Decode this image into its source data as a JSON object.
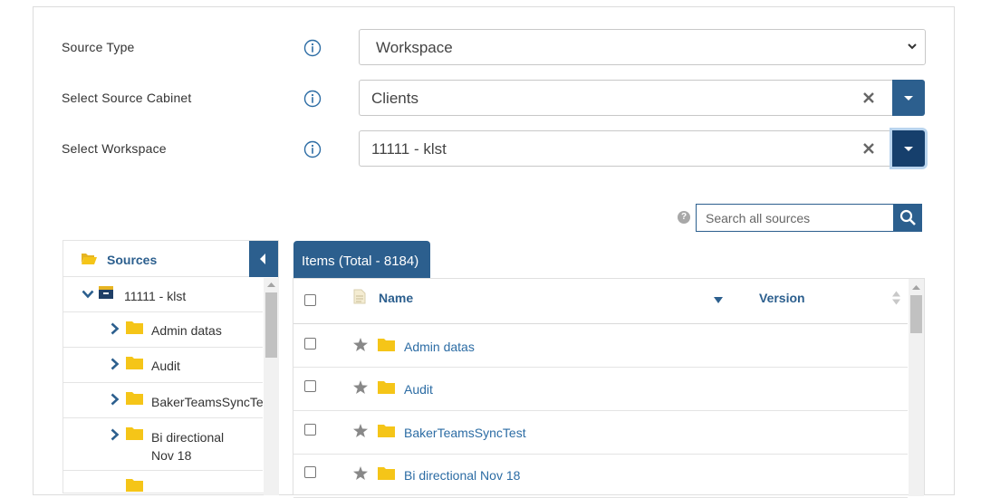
{
  "form": {
    "source_type": {
      "label": "Source Type",
      "value": "Workspace"
    },
    "source_cabinet": {
      "label": "Select Source Cabinet",
      "value": "Clients"
    },
    "workspace": {
      "label": "Select Workspace",
      "value": "11111 - klst"
    }
  },
  "search": {
    "placeholder": "Search all sources",
    "help": "?"
  },
  "sources_panel": {
    "title": "Sources",
    "root": "11111 - klst",
    "items": [
      {
        "label": "Admin datas"
      },
      {
        "label": "Audit"
      },
      {
        "label": "BakerTeamsSyncTest"
      },
      {
        "label_line1": "Bi directional",
        "label_line2": "Nov 18"
      }
    ]
  },
  "items_panel": {
    "tab_label": "Items (Total - 8184)",
    "columns": {
      "name": "Name",
      "version": "Version"
    },
    "rows": [
      {
        "name": "Admin datas"
      },
      {
        "name": "Audit"
      },
      {
        "name": "BakerTeamsSyncTest"
      },
      {
        "name": "Bi directional Nov 18"
      }
    ]
  },
  "colors": {
    "primary": "#2c5f8e",
    "primary_dark": "#163f6c",
    "folder": "#f5c518",
    "link": "#2c6ca4"
  },
  "icons": [
    "info-icon",
    "chevron-down-icon",
    "clear-icon",
    "caret-down-icon",
    "help-icon",
    "search-icon",
    "folder-open-icon",
    "collapse-left-icon",
    "expand-chevron-icon",
    "folder-icon",
    "star-icon",
    "file-icon",
    "sort-desc-icon",
    "sort-icon"
  ]
}
